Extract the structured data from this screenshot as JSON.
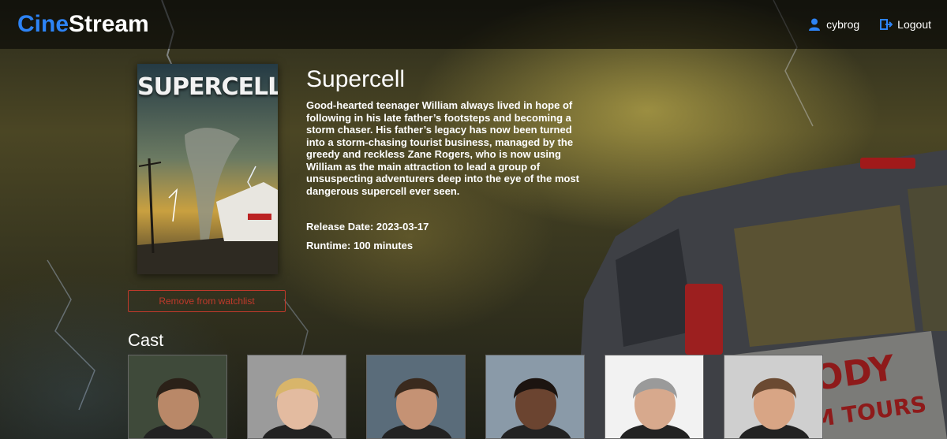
{
  "app": {
    "logo_part1": "Cine",
    "logo_part2": "Stream"
  },
  "header": {
    "username": "cybrog",
    "logout_label": "Logout"
  },
  "movie": {
    "title": "Supercell",
    "poster_title": "SUPERCELL",
    "overview": "Good-hearted teenager William always lived in hope of following in his late father’s footsteps and becoming a storm chaser. His father’s legacy has now been turned into a storm-chasing tourist business, managed by the greedy and reckless Zane Rogers, who is now using William as the main attraction to lead a group of unsuspecting adventurers deep into the eye of the most dangerous supercell ever seen.",
    "release_date": "Release Date: 2023-03-17",
    "runtime": "Runtime: 100 minutes"
  },
  "actions": {
    "watchlist_label": "Remove from watchlist"
  },
  "cast": {
    "heading": "Cast",
    "members": [
      {
        "bg": "#3f4a3a",
        "hair": "#2b2118",
        "skin": "#b98868"
      },
      {
        "bg": "#9b9b9b",
        "hair": "#d8b56a",
        "skin": "#e3bba0"
      },
      {
        "bg": "#5a6c7a",
        "hair": "#3a2a1e",
        "skin": "#c59274"
      },
      {
        "bg": "#8a9aa8",
        "hair": "#1c1410",
        "skin": "#6b4430"
      },
      {
        "bg": "#f2f2f2",
        "hair": "#9a9a9a",
        "skin": "#d7a98d"
      },
      {
        "bg": "#cfcfcf",
        "hair": "#6b4a32",
        "skin": "#d8a585"
      }
    ]
  }
}
